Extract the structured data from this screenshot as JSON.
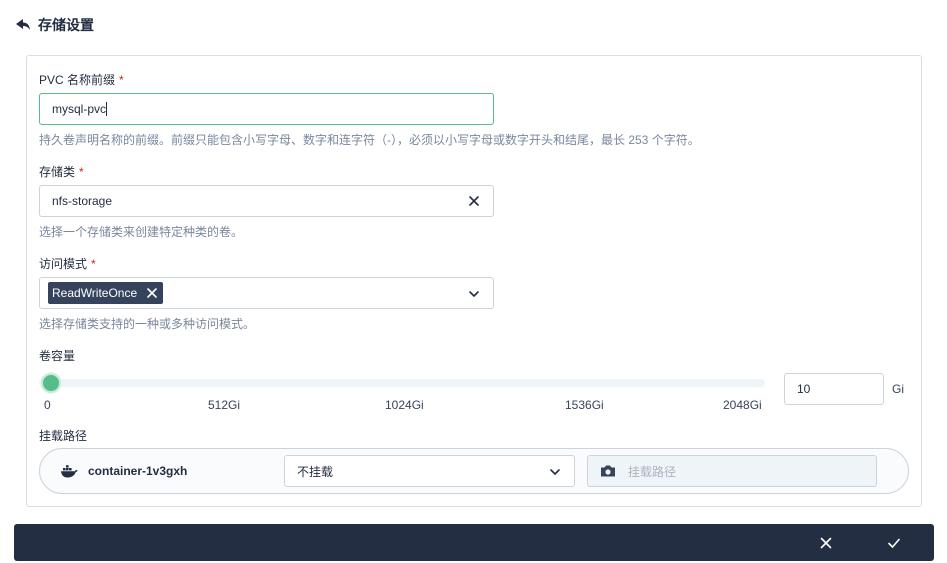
{
  "header": {
    "title": "存储设置",
    "back_icon": "back-arrow-icon"
  },
  "form": {
    "pvc_prefix": {
      "label": "PVC 名称前缀",
      "required_mark": "*",
      "value": "mysql-pvc",
      "description": "持久卷声明名称的前缀。前缀只能包含小写字母、数字和连字符（-），必须以小写字母或数字开头和结尾，最长 253 个字符。"
    },
    "storage_class": {
      "label": "存储类",
      "required_mark": "*",
      "value": "nfs-storage",
      "description": "选择一个存储类来创建特定种类的卷。"
    },
    "access_mode": {
      "label": "访问模式",
      "required_mark": "*",
      "tags": [
        "ReadWriteOnce"
      ],
      "description": "选择存储类支持的一种或多种访问模式。"
    },
    "capacity": {
      "label": "卷容量",
      "ticks": [
        "0",
        "512Gi",
        "1024Gi",
        "1536Gi",
        "2048Gi"
      ],
      "slider_value": 10,
      "slider_max": 2048,
      "value": "10",
      "unit": "Gi"
    },
    "mount": {
      "label": "挂载路径",
      "container_name": "container-1v3gxh",
      "mode_value": "不挂载",
      "path_placeholder": "挂载路径"
    }
  },
  "colors": {
    "accent": "#55bc8a",
    "required": "#ca2621",
    "footer_bg": "#242e42",
    "tag_bg": "#36435c"
  }
}
